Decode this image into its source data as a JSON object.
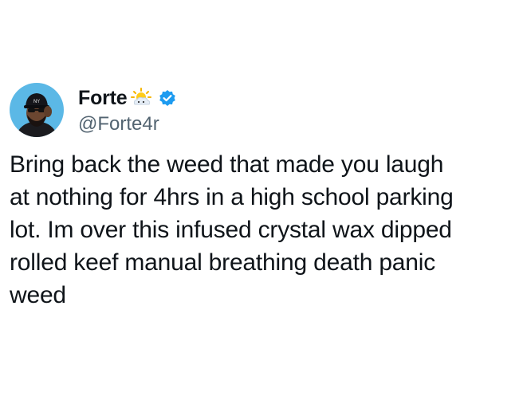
{
  "author": {
    "display_name": "Forte",
    "handle": "@Forte4r",
    "avatar_icon": "avatar-icon",
    "emoji_icon": "sun-behind-cloud-icon",
    "verified_icon": "verified-badge-icon",
    "verified_color": "#1d9bf0"
  },
  "tweet": {
    "text": "Bring back the weed that made you laugh\nat nothing for 4hrs in a high school parking\nlot. Im over this infused crystal wax dipped\nrolled keef manual breathing death panic\nweed"
  },
  "colors": {
    "text": "#0f1419",
    "secondary": "#536471",
    "avatar_bg": "#5bb8e6"
  }
}
